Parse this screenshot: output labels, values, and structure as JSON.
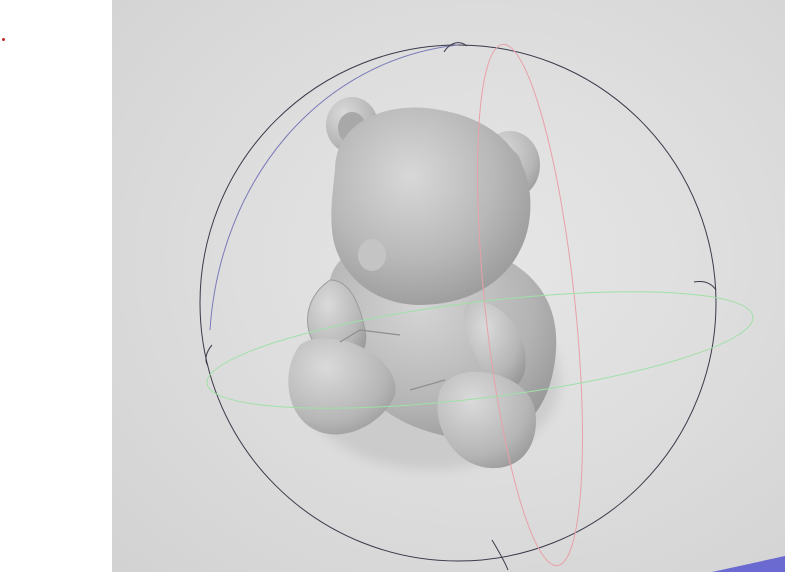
{
  "app": {
    "status_indicator_color": "#c62828"
  },
  "viewport": {
    "background_color": "#dcdcdc",
    "model": {
      "name": "teddy-bear",
      "shading": "smooth-gray",
      "base_color": "#bfbfbf"
    },
    "gizmo": {
      "type": "rotation",
      "outer_circle_color": "#3a3a4a",
      "rings": [
        {
          "axis": "x",
          "color": "#e8a0a8"
        },
        {
          "axis": "y",
          "color": "#9fe0a6"
        },
        {
          "axis": "z",
          "color": "#7a7ab8"
        }
      ]
    },
    "corner_triangle_color": "#6a6ad0"
  }
}
